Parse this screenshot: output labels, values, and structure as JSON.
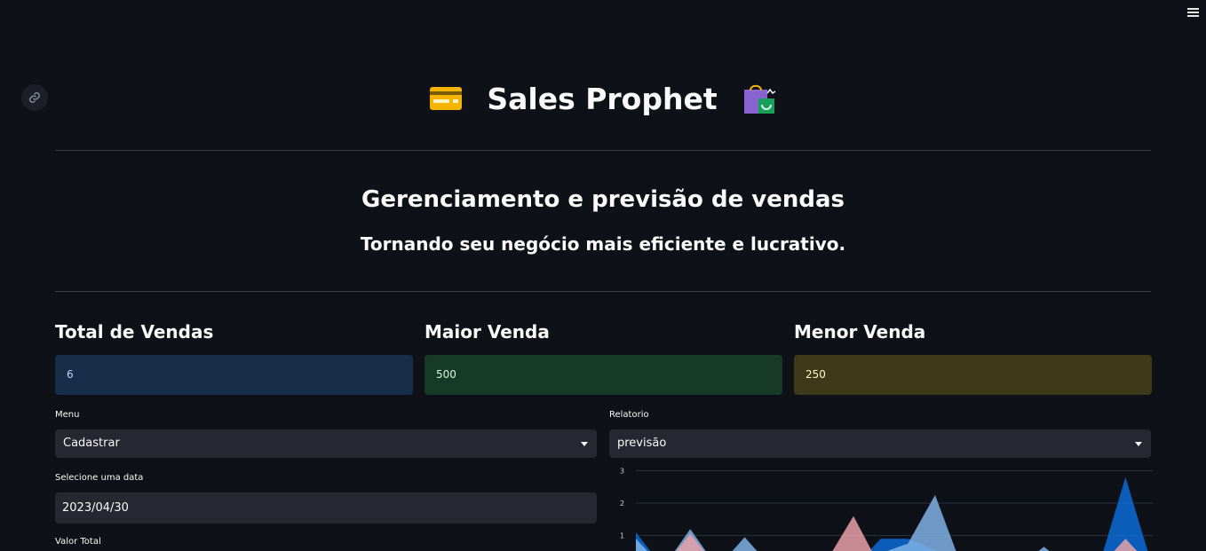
{
  "app": {
    "title": "Sales Prophet",
    "title_icon_left": "credit-card-icon",
    "title_icon_right": "shopping-bags-icon"
  },
  "header": {
    "heading": "Gerenciamento e previsão de vendas",
    "subheading": "Tornando seu negócio mais eficiente e lucrativo."
  },
  "metrics": [
    {
      "label": "Total de Vendas",
      "value": "6",
      "bg": "#172d48",
      "fg": "#b9d9ff"
    },
    {
      "label": "Maior Venda",
      "value": "500",
      "bg": "#173928",
      "fg": "#d7f5dd"
    },
    {
      "label": "Menor Venda",
      "value": "250",
      "bg": "#3e3a19",
      "fg": "#fff6c9"
    }
  ],
  "left_panel": {
    "menu_label": "Menu",
    "menu_value": "Cadastrar",
    "date_label": "Selecione uma data",
    "date_value": "2023/04/30",
    "total_label": "Valor Total"
  },
  "right_panel": {
    "report_label": "Relatorio",
    "report_value": "previsão"
  },
  "chart_data": {
    "type": "area",
    "y_ticks": [
      "3",
      "2",
      "1"
    ],
    "ylim": [
      0,
      3
    ],
    "grid": true,
    "series": [
      {
        "color": "#0b6bd6",
        "values": [
          1.1,
          0,
          0.6,
          0,
          0.3,
          0,
          0.1,
          0.35,
          0,
          0.9,
          0.9,
          0.55,
          0,
          0.15,
          0,
          0,
          0,
          0,
          2.8,
          0
        ]
      },
      {
        "color": "#7fb2e6",
        "values": [
          0.9,
          0,
          1.2,
          0,
          0.95,
          0,
          0.2,
          0.1,
          0,
          0.45,
          0.75,
          2.25,
          0,
          0,
          0,
          0.65,
          0,
          0,
          0,
          0
        ]
      },
      {
        "color": "#e8a0a8",
        "values": [
          0,
          0,
          1.05,
          0,
          0,
          0,
          0.15,
          0.2,
          1.6,
          0,
          0,
          0,
          0,
          0,
          0,
          0,
          0,
          0,
          0.9,
          0
        ]
      }
    ]
  }
}
